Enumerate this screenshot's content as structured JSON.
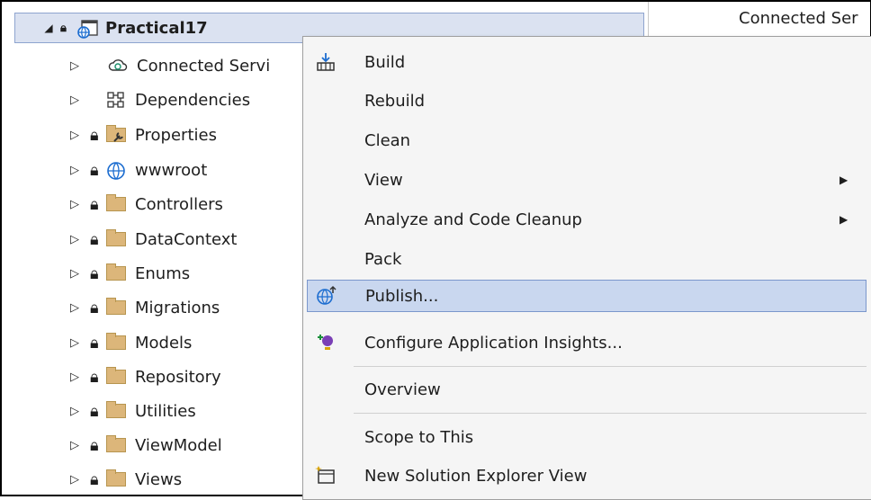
{
  "right_pane": {
    "title": "Connected Ser"
  },
  "tree": {
    "project": "Practical17",
    "items": [
      {
        "label": "Connected Servi",
        "icon": "connected-services-icon"
      },
      {
        "label": "Dependencies",
        "icon": "dependencies-icon"
      },
      {
        "label": "Properties",
        "icon": "properties-folder-icon"
      },
      {
        "label": "wwwroot",
        "icon": "globe-icon"
      },
      {
        "label": "Controllers",
        "icon": "folder-icon"
      },
      {
        "label": "DataContext",
        "icon": "folder-icon"
      },
      {
        "label": "Enums",
        "icon": "folder-icon"
      },
      {
        "label": "Migrations",
        "icon": "folder-icon"
      },
      {
        "label": "Models",
        "icon": "folder-icon"
      },
      {
        "label": "Repository",
        "icon": "folder-icon"
      },
      {
        "label": "Utilities",
        "icon": "folder-icon"
      },
      {
        "label": "ViewModel",
        "icon": "folder-icon"
      },
      {
        "label": "Views",
        "icon": "folder-icon"
      }
    ]
  },
  "menu": {
    "build": "Build",
    "rebuild": "Rebuild",
    "clean": "Clean",
    "view": "View",
    "analyze": "Analyze and Code Cleanup",
    "pack": "Pack",
    "publish": "Publish...",
    "configure_insights": "Configure Application Insights...",
    "overview": "Overview",
    "scope": "Scope to This",
    "new_view": "New Solution Explorer View"
  },
  "colors": {
    "selection": "#dbe2f1",
    "menu_hover": "#c9d7ef",
    "folder": "#dcb67a"
  }
}
